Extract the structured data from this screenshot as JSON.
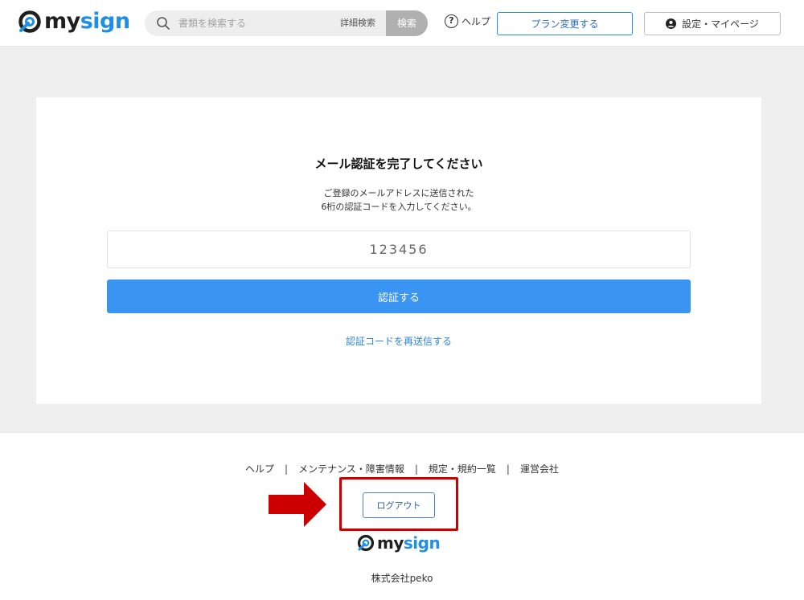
{
  "header": {
    "logo": {
      "part1": "my",
      "part2": "sign"
    },
    "search": {
      "placeholder": "書類を検索する",
      "advanced_label": "詳細検索",
      "button_label": "検索"
    },
    "help_label": "ヘルプ",
    "plan_button_label": "プラン変更する",
    "settings_button_label": "設定・マイページ"
  },
  "verification": {
    "title": "メール認証を完了してください",
    "description_line1": "ご登録のメールアドレスに送信された",
    "description_line2": "6桁の認証コードを入力してください。",
    "code_placeholder": "123456",
    "submit_label": "認証する",
    "resend_label": "認証コードを再送信する"
  },
  "footer": {
    "links": [
      "ヘルプ",
      "メンテナンス・障害情報",
      "規定・規約一覧",
      "運営会社"
    ],
    "separator": "|",
    "logout_label": "ログアウト",
    "logo": {
      "part1": "my",
      "part2": "sign"
    },
    "company": "株式会社peko"
  },
  "colors": {
    "brand_blue": "#1e8ee6",
    "primary_button": "#3a94f2",
    "annotation_red": "#cc0000",
    "band_gray": "#efefef"
  },
  "icons": [
    "search-icon",
    "help-icon",
    "user-icon",
    "logo-mark-icon",
    "red-arrow-icon"
  ]
}
